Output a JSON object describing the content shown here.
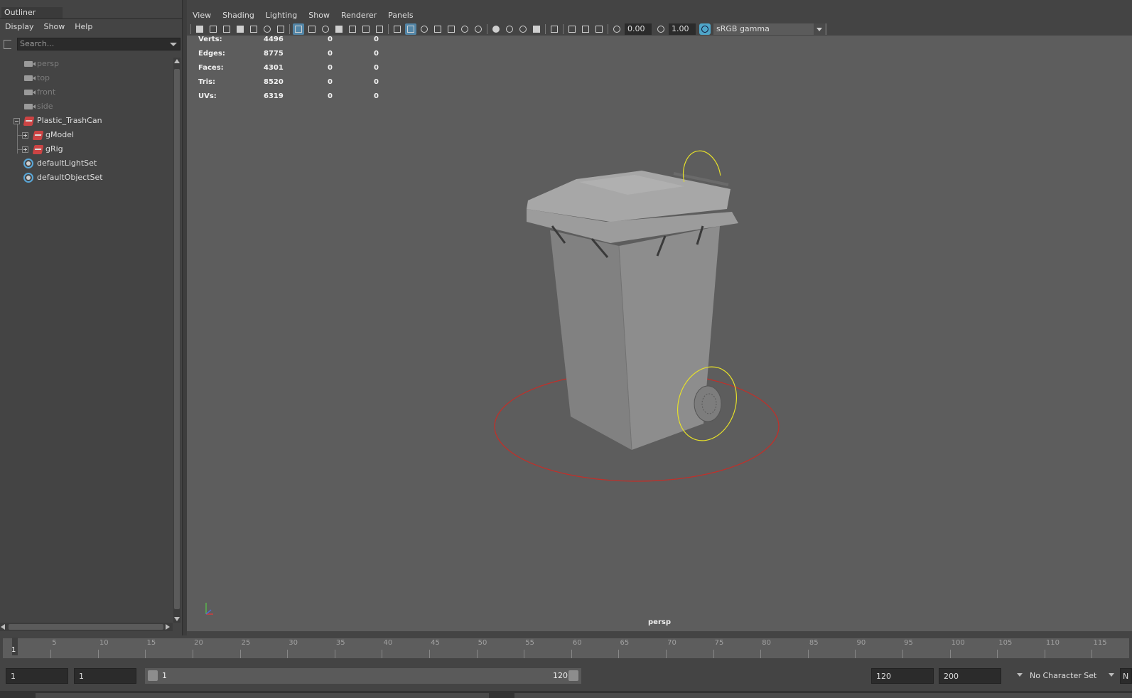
{
  "outliner": {
    "tab_label": "Outliner",
    "menu": [
      "Display",
      "Show",
      "Help"
    ],
    "search_placeholder": "Search...",
    "items": [
      {
        "label": "persp",
        "type": "camera",
        "dimmed": true
      },
      {
        "label": "top",
        "type": "camera",
        "dimmed": true
      },
      {
        "label": "front",
        "type": "camera",
        "dimmed": true
      },
      {
        "label": "side",
        "type": "camera",
        "dimmed": true
      },
      {
        "label": "Plastic_TrashCan",
        "type": "group",
        "expanded": true
      },
      {
        "label": "gModel",
        "type": "group",
        "expanded": false
      },
      {
        "label": "gRig",
        "type": "group",
        "expanded": false
      },
      {
        "label": "defaultLightSet",
        "type": "set"
      },
      {
        "label": "defaultObjectSet",
        "type": "set"
      }
    ]
  },
  "panel": {
    "menu": [
      "View",
      "Shading",
      "Lighting",
      "Show",
      "Renderer",
      "Panels"
    ],
    "exposure": "0.00",
    "gamma": "1.00",
    "color_space": "sRGB gamma"
  },
  "hud": [
    {
      "label": "Verts:",
      "v1": "4496",
      "v2": "0",
      "v3": "0"
    },
    {
      "label": "Edges:",
      "v1": "8775",
      "v2": "0",
      "v3": "0"
    },
    {
      "label": "Faces:",
      "v1": "4301",
      "v2": "0",
      "v3": "0"
    },
    {
      "label": "Tris:",
      "v1": "8520",
      "v2": "0",
      "v3": "0"
    },
    {
      "label": "UVs:",
      "v1": "6319",
      "v2": "0",
      "v3": "0"
    }
  ],
  "viewport": {
    "camera_label": "persp",
    "colors": {
      "background": "#5d5d5d",
      "model": "#8a8a8a",
      "ground_ctrl": "#c0302a",
      "wheel_ctrl": "#e6e02a"
    }
  },
  "timeline": {
    "current_frame": "1",
    "ticks": [
      "5",
      "10",
      "15",
      "20",
      "25",
      "30",
      "35",
      "40",
      "45",
      "50",
      "55",
      "60",
      "65",
      "70",
      "75",
      "80",
      "85",
      "90",
      "95",
      "100",
      "105",
      "110",
      "115"
    ]
  },
  "range": {
    "start_time": "1",
    "playback_start": "1",
    "slider_start": "1",
    "slider_end": "120",
    "playback_end": "120",
    "end_time": "200",
    "character_set": "No Character Set",
    "cut_text": "N"
  }
}
